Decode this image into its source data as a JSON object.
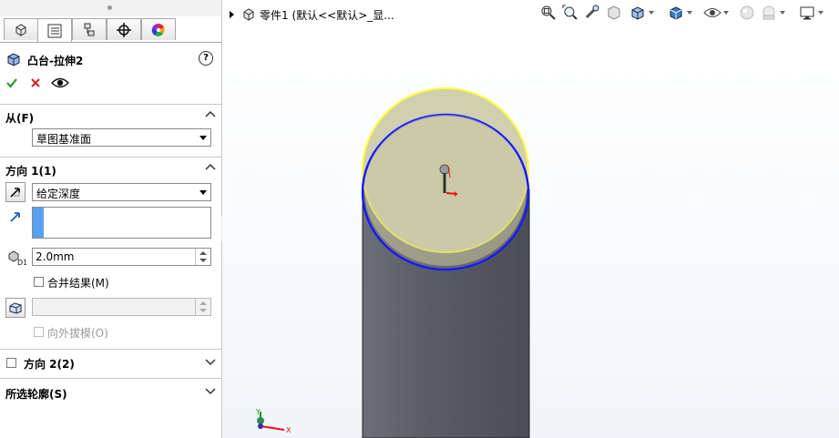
{
  "property_manager": {
    "tabs": [
      "feature-manager",
      "property-manager",
      "configuration-manager",
      "dimxpert-manager",
      "display-manager"
    ],
    "title": "凸台-拉伸2",
    "help": "?",
    "from": {
      "label": "从(F)",
      "value": "草图基准面"
    },
    "direction1": {
      "label": "方向 1(1)",
      "end_condition": "给定深度",
      "depth": "2.0mm",
      "merge_result": "合并结果(M)",
      "merge_checked": false,
      "draft_outward": "向外拔模(O)",
      "draft_enabled": false
    },
    "direction2": {
      "label": "方向 2(2)",
      "checked": false
    },
    "selected_contours": {
      "label": "所选轮廓(S)"
    }
  },
  "viewport": {
    "tree_label": "零件1  (默认<<默认>_显...",
    "model_colors": {
      "cylinder_side": "#55585f",
      "top_face": "#c7c4a0",
      "preview_edge": "#ffff3a",
      "sketch_edge": "#1a1aff"
    },
    "triad": {
      "x": "X",
      "y": "Y"
    }
  },
  "colors": {
    "ok": "#2e9b2e",
    "cancel": "#d21e1e",
    "accent": "#5aa0f0"
  }
}
